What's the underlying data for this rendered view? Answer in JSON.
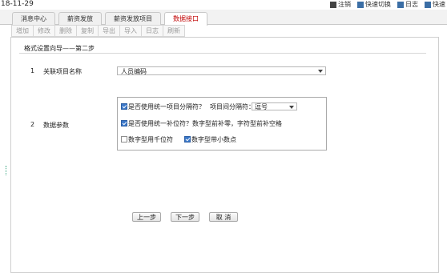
{
  "header": {
    "date": "18-11-29",
    "links": [
      {
        "label": "注销",
        "icon": "logout-icon"
      },
      {
        "label": "快速切换",
        "icon": "switch-icon"
      },
      {
        "label": "日志",
        "icon": "log-icon"
      },
      {
        "label": "快速",
        "icon": "quick-icon"
      }
    ]
  },
  "tabs": [
    {
      "label": "消息中心"
    },
    {
      "label": "薪资发放"
    },
    {
      "label": "薪资发放项目"
    },
    {
      "label": "数据接口",
      "active": true
    }
  ],
  "toolbar": [
    "增加",
    "修改",
    "删除",
    "复制",
    "导出",
    "导入",
    "日志",
    "刷新"
  ],
  "wizard": {
    "title": "格式设置向导——第二步",
    "row1": {
      "num": "1",
      "label": "关联项目名称",
      "value": "人员编码"
    },
    "row2": {
      "num": "2",
      "label": "数据参数"
    },
    "options": {
      "unified_separator": {
        "label": "是否使用统一项目分隔符？",
        "checked": true
      },
      "separator_label": "项目间分隔符：",
      "separator_value": "逗号",
      "unified_padding": {
        "label": "是否使用统一补位符？数字型前补零，字符型前补空格",
        "checked": true
      },
      "thousands_sep": {
        "label": "数字型用千位符",
        "checked": false
      },
      "decimal_point": {
        "label": "数字型带小数点",
        "checked": true
      }
    }
  },
  "buttons": {
    "prev": "上一步",
    "next": "下一步",
    "cancel": "取 消"
  }
}
